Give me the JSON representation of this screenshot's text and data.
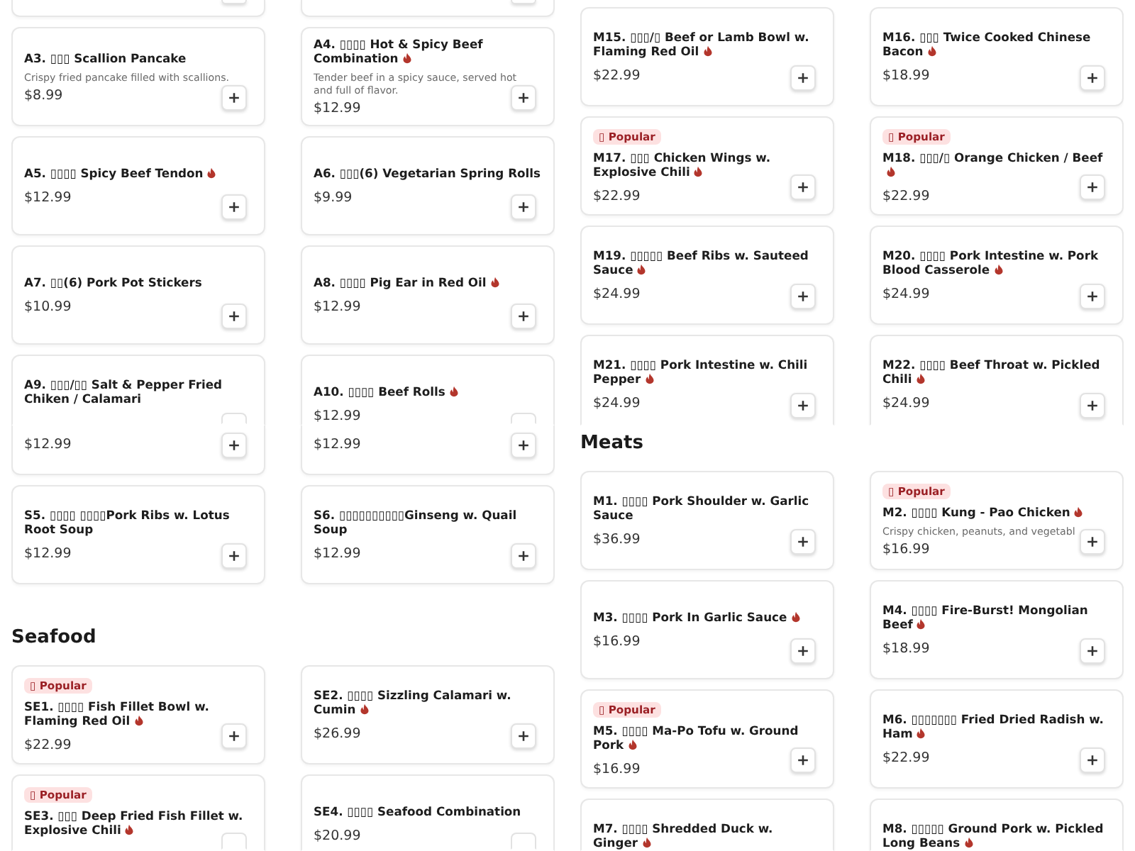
{
  "columns": [
    {
      "views": [
        {
          "sections": [
            {
              "rows": [
                {
                  "cards": [
                    {
                      "kind": "partial"
                    },
                    {
                      "kind": "partial"
                    }
                  ]
                },
                {
                  "cards": [
                    {
                      "kind": "dish",
                      "title": "A3. ▯▯▯ Scallion Pancake",
                      "spicy": false,
                      "description": "Crispy fried pancake filled with scallions.",
                      "price": "$8.99"
                    },
                    {
                      "kind": "dish",
                      "title": "A4. ▯▯▯▯ Hot & Spicy Beef Combination",
                      "spicy": true,
                      "description": "Tender beef in a spicy sauce, served hot and full of flavor.",
                      "price": "$12.99"
                    }
                  ]
                },
                {
                  "cards": [
                    {
                      "kind": "dish",
                      "title": "A5. ▯▯▯▯ Spicy Beef Tendon",
                      "spicy": true,
                      "price": "$12.99"
                    },
                    {
                      "kind": "dish",
                      "title": "A6. ▯▯▯(6) Vegetarian Spring Rolls",
                      "spicy": false,
                      "price": "$9.99"
                    }
                  ]
                },
                {
                  "cards": [
                    {
                      "kind": "dish",
                      "title": "A7. ▯▯(6) Pork Pot Stickers",
                      "spicy": false,
                      "price": "$10.99"
                    },
                    {
                      "kind": "dish",
                      "title": "A8. ▯▯▯▯ Pig Ear in Red Oil",
                      "spicy": true,
                      "price": "$12.99"
                    }
                  ]
                },
                {
                  "cards": [
                    {
                      "kind": "dish",
                      "title": "A9. ▯▯▯/▯▯ Salt & Pepper Fried Chiken / Calamari",
                      "spicy": false
                    },
                    {
                      "kind": "dish",
                      "title": "A10. ▯▯▯▯ Beef Rolls",
                      "spicy": true,
                      "price": "$12.99"
                    }
                  ]
                }
              ]
            }
          ]
        },
        {
          "sections": [
            {
              "rows": [
                {
                  "cards": [
                    {
                      "kind": "partial",
                      "price": "$12.99"
                    },
                    {
                      "kind": "partial",
                      "price": "$12.99"
                    }
                  ]
                },
                {
                  "cards": [
                    {
                      "kind": "dish",
                      "title": "S5. ▯▯▯▯ ▯▯▯▯Pork Ribs w. Lotus Root Soup",
                      "spicy": false,
                      "price": "$12.99"
                    },
                    {
                      "kind": "dish",
                      "title": "S6. ▯▯▯▯▯▯▯▯▯▯Ginseng w. Quail Soup",
                      "spicy": false,
                      "price": "$12.99"
                    }
                  ]
                }
              ]
            },
            {
              "heading": "Seafood",
              "rows": [
                {
                  "cards": [
                    {
                      "kind": "dish",
                      "badge": "▯ Popular",
                      "title": "SE1. ▯▯▯▯ Fish Fillet Bowl w. Flaming Red Oil",
                      "spicy": true,
                      "price": "$22.99"
                    },
                    {
                      "kind": "dish",
                      "title": "SE2. ▯▯▯▯ Sizzling Calamari w. Cumin",
                      "spicy": true,
                      "price": "$26.99"
                    }
                  ]
                },
                {
                  "cards": [
                    {
                      "kind": "dish",
                      "badge": "▯ Popular",
                      "title": "SE3. ▯▯▯ Deep Fried Fish Fillet w. Explosive Chili",
                      "spicy": true
                    },
                    {
                      "kind": "dish",
                      "title": "SE4. ▯▯▯▯ Seafood Combination",
                      "spicy": false,
                      "price": "$20.99"
                    }
                  ]
                }
              ]
            }
          ]
        }
      ]
    },
    {
      "views": [
        {
          "sections": [
            {
              "rows": [
                {
                  "cards": [
                    {
                      "kind": "dish",
                      "title": "M15. ▯▯▯/▯ Beef or Lamb Bowl w. Flaming Red Oil",
                      "spicy": true,
                      "price": "$22.99"
                    },
                    {
                      "kind": "dish",
                      "title": "M16. ▯▯▯ Twice Cooked Chinese Bacon",
                      "spicy": true,
                      "price": "$18.99"
                    }
                  ]
                },
                {
                  "cards": [
                    {
                      "kind": "dish",
                      "badge": "▯ Popular",
                      "title": "M17. ▯▯▯ Chicken Wings w. Explosive Chili",
                      "spicy": true,
                      "price": "$22.99"
                    },
                    {
                      "kind": "dish",
                      "badge": "▯ Popular",
                      "title": "M18. ▯▯▯/▯ Orange Chicken / Beef",
                      "spicy": true,
                      "price": "$22.99"
                    }
                  ]
                },
                {
                  "cards": [
                    {
                      "kind": "dish",
                      "title": "M19. ▯▯▯▯▯ Beef Ribs w. Sauteed Sauce",
                      "spicy": true,
                      "price": "$24.99"
                    },
                    {
                      "kind": "dish",
                      "title": "M20. ▯▯▯▯ Pork Intestine w. Pork Blood Casserole",
                      "spicy": true,
                      "price": "$24.99"
                    }
                  ]
                },
                {
                  "cards": [
                    {
                      "kind": "dish",
                      "title": "M21. ▯▯▯▯ Pork Intestine w. Chili Pepper",
                      "spicy": true,
                      "price": "$24.99"
                    },
                    {
                      "kind": "dish",
                      "title": "M22. ▯▯▯▯ Beef Throat w. Pickled Chili",
                      "spicy": true,
                      "price": "$24.99"
                    }
                  ]
                }
              ]
            }
          ]
        },
        {
          "sections": [
            {
              "heading": "Meats",
              "rows": [
                {
                  "cards": [
                    {
                      "kind": "dish",
                      "title": "M1. ▯▯▯▯ Pork Shoulder w. Garlic Sauce",
                      "spicy": false,
                      "price": "$36.99"
                    },
                    {
                      "kind": "dish",
                      "badge": "▯ Popular",
                      "title": "M2. ▯▯▯▯ Kung - Pao Chicken",
                      "spicy": true,
                      "description": "Crispy chicken, peanuts, and vegetabl",
                      "price": "$16.99"
                    }
                  ]
                },
                {
                  "cards": [
                    {
                      "kind": "dish",
                      "title": "M3. ▯▯▯▯ Pork In Garlic Sauce",
                      "spicy": true,
                      "price": "$16.99"
                    },
                    {
                      "kind": "dish",
                      "title": "M4. ▯▯▯▯ Fire-Burst! Mongolian Beef",
                      "spicy": true,
                      "price": "$18.99"
                    }
                  ]
                },
                {
                  "cards": [
                    {
                      "kind": "dish",
                      "badge": "▯ Popular",
                      "title": "M5. ▯▯▯▯ Ma-Po Tofu w. Ground Pork",
                      "spicy": true,
                      "price": "$16.99"
                    },
                    {
                      "kind": "dish",
                      "title": "M6. ▯▯▯▯▯▯▯ Fried Dried Radish w. Ham",
                      "spicy": true,
                      "price": "$22.99"
                    }
                  ]
                },
                {
                  "cards": [
                    {
                      "kind": "dish",
                      "title": "M7. ▯▯▯▯ Shredded Duck w. Ginger",
                      "spicy": true
                    },
                    {
                      "kind": "dish",
                      "title": "M8. ▯▯▯▯▯ Ground Pork w. Pickled Long Beans",
                      "spicy": true
                    }
                  ]
                }
              ]
            }
          ]
        }
      ]
    }
  ]
}
